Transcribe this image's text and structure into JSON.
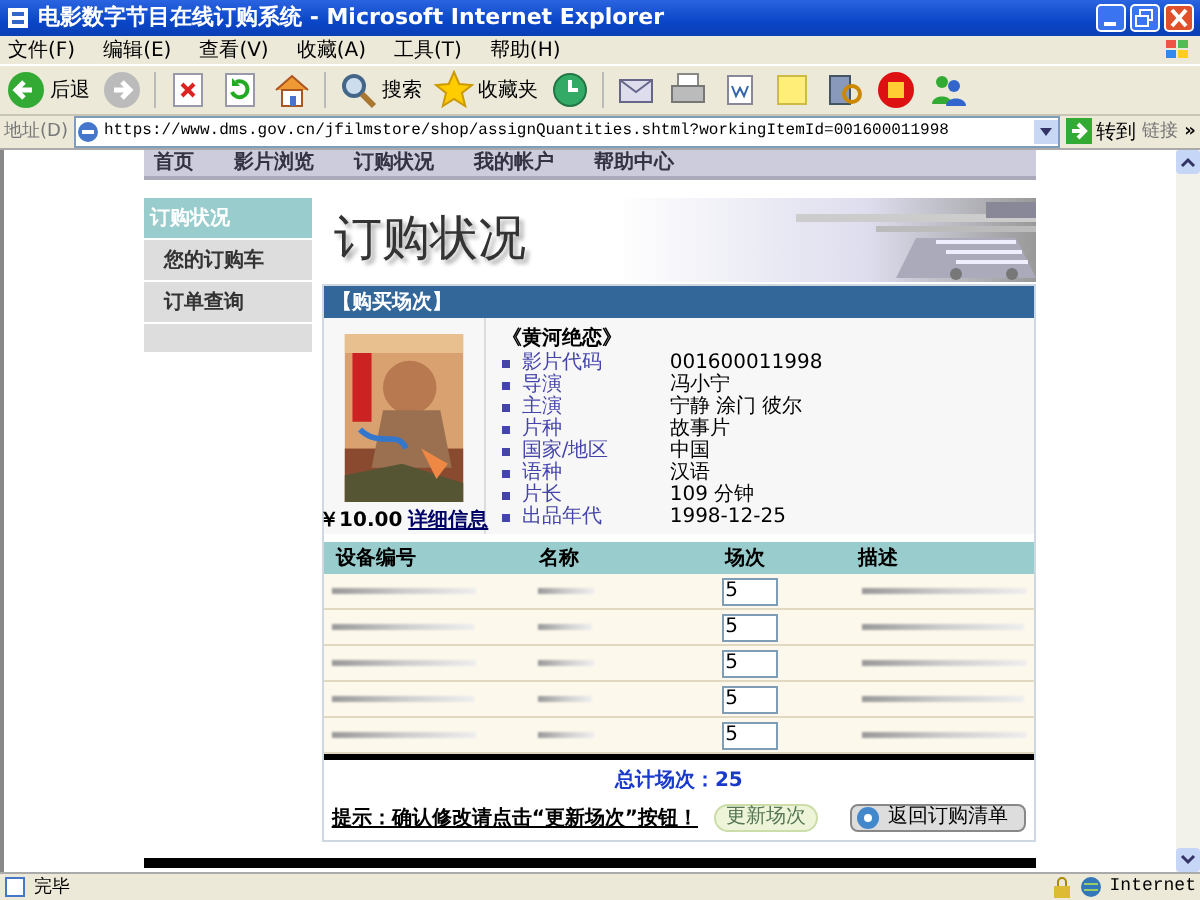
{
  "window": {
    "title": "电影数字节目在线订购系统 - Microsoft Internet Explorer"
  },
  "menu": [
    "文件(F)",
    "编辑(E)",
    "查看(V)",
    "收藏(A)",
    "工具(T)",
    "帮助(H)"
  ],
  "toolbar": [
    {
      "kind": "back",
      "label": "后退"
    },
    {
      "kind": "forward"
    },
    {
      "kind": "stop"
    },
    {
      "kind": "refresh"
    },
    {
      "kind": "home"
    },
    {
      "kind": "search",
      "label": "搜索"
    },
    {
      "kind": "favorites",
      "label": "收藏夹"
    },
    {
      "kind": "history"
    },
    {
      "kind": "mail"
    },
    {
      "kind": "print"
    },
    {
      "kind": "edit"
    },
    {
      "kind": "note"
    },
    {
      "kind": "research"
    },
    {
      "kind": "stamp"
    },
    {
      "kind": "messenger"
    }
  ],
  "address": {
    "label": "地址(D)",
    "url": "https://www.dms.gov.cn/jfilmstore/shop/assignQuantities.shtml?workingItemId=001600011998",
    "go": "转到",
    "links": "链接",
    "more": "»"
  },
  "nav": [
    "首页",
    "影片浏览",
    "订购状况",
    "我的帐户",
    "帮助中心"
  ],
  "sidebar": {
    "header": "订购状况",
    "items": [
      {
        "label": "您的订购车"
      },
      {
        "label": "订单查询"
      }
    ]
  },
  "heading": "订购状况",
  "panel": {
    "title": "【购买场次】",
    "film": {
      "title": "《黄河绝恋》",
      "price": "￥10.00",
      "details_link": "详细信息",
      "fields": [
        {
          "label": "影片代码",
          "value": "001600011998"
        },
        {
          "label": "导演",
          "value": "冯小宁"
        },
        {
          "label": "主演",
          "value": "宁静 涂门 彼尔"
        },
        {
          "label": "片种",
          "value": "故事片"
        },
        {
          "label": "国家/地区",
          "value": "中国"
        },
        {
          "label": "语种",
          "value": "汉语"
        },
        {
          "label": "片长",
          "value": "109 分钟"
        },
        {
          "label": "出品年代",
          "value": "1998-12-25"
        }
      ]
    },
    "table": {
      "columns": [
        "设备编号",
        "名称",
        "场次",
        "描述"
      ],
      "rows": [
        {
          "sessions": "5"
        },
        {
          "sessions": "5"
        },
        {
          "sessions": "5"
        },
        {
          "sessions": "5"
        },
        {
          "sessions": "5"
        }
      ]
    },
    "total": "总计场次：25",
    "hint": "提示：确认修改请点击“更新场次”按钮！",
    "update_button": "更新场次",
    "back_button": "返回订购清单"
  },
  "status_bar": {
    "text": "完毕",
    "zone": "Internet"
  }
}
